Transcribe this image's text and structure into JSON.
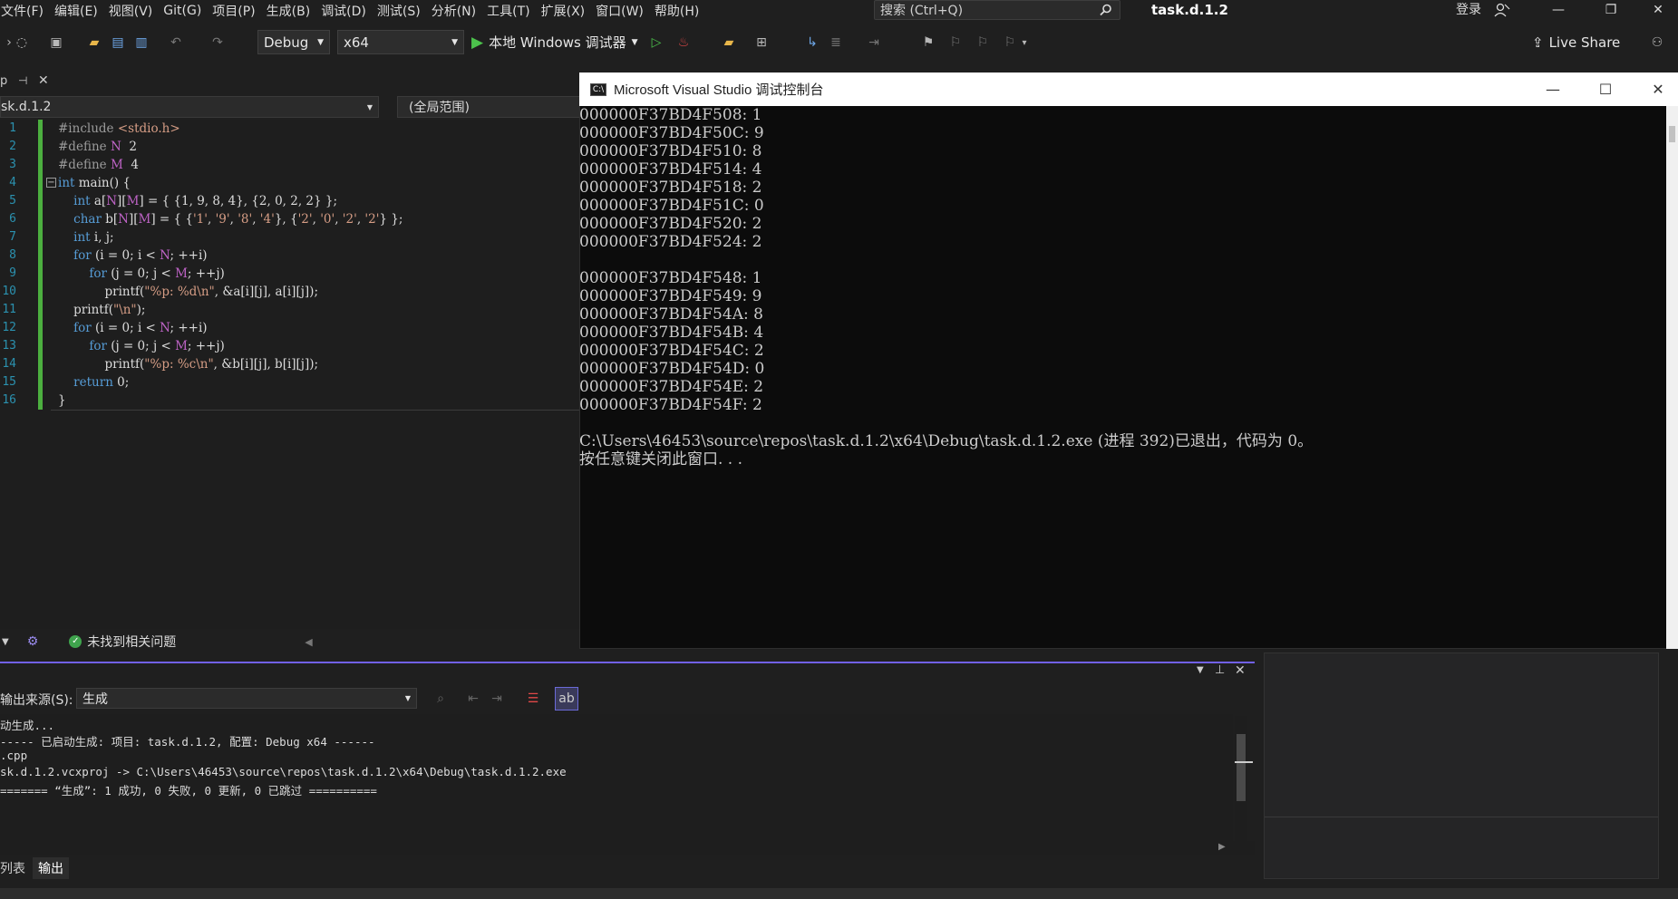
{
  "menu": [
    "文件(F)",
    "编辑(E)",
    "视图(V)",
    "Git(G)",
    "项目(P)",
    "生成(B)",
    "调试(D)",
    "测试(S)",
    "分析(N)",
    "工具(T)",
    "扩展(X)",
    "窗口(W)",
    "帮助(H)"
  ],
  "search": {
    "placeholder": "搜索 (Ctrl+Q)"
  },
  "window_title": "task.d.1.2",
  "login_label": "登录",
  "toolbar": {
    "config": "Debug",
    "platform": "x64",
    "run_label": "本地 Windows 调试器",
    "live_share": "Live Share"
  },
  "editor": {
    "file": "task.d.1.2",
    "file_display": "sk.d.1.2",
    "scope": "(全局范围)",
    "status": "未找到相关问题",
    "line_numbers": [
      "1",
      "2",
      "3",
      "4",
      "5",
      "6",
      "7",
      "8",
      "9",
      "10",
      "11",
      "12",
      "13",
      "14",
      "15",
      "16"
    ]
  },
  "output": {
    "source_label": "输出来源(S):",
    "source_value": "生成",
    "lines": [
      "动生成...",
      "----- 已启动生成: 项目: task.d.1.2, 配置: Debug x64 ------",
      ".cpp",
      "sk.d.1.2.vcxproj -> C:\\Users\\46453\\source\\repos\\task.d.1.2\\x64\\Debug\\task.d.1.2.exe",
      "======= “生成”: 1 成功, 0 失败, 0 更新, 0 已跳过 =========="
    ],
    "tabs": [
      "列表",
      "输出"
    ]
  },
  "console": {
    "title": "Microsoft Visual Studio 调试控制台",
    "lines": [
      "000000F37BD4F508: 1",
      "000000F37BD4F50C: 9",
      "000000F37BD4F510: 8",
      "000000F37BD4F514: 4",
      "000000F37BD4F518: 2",
      "000000F37BD4F51C: 0",
      "000000F37BD4F520: 2",
      "000000F37BD4F524: 2",
      "",
      "000000F37BD4F548: 1",
      "000000F37BD4F549: 9",
      "000000F37BD4F54A: 8",
      "000000F37BD4F54B: 4",
      "000000F37BD4F54C: 2",
      "000000F37BD4F54D: 0",
      "000000F37BD4F54E: 2",
      "000000F37BD4F54F: 2",
      "",
      "C:\\Users\\46453\\source\\repos\\task.d.1.2\\x64\\Debug\\task.d.1.2.exe (进程 392)已退出，代码为 0。",
      "按任意键关闭此窗口. . ."
    ]
  },
  "colors": {
    "accent": "#7160e8",
    "gutter_green": "#4caf3f",
    "keyword": "#569cd6"
  }
}
